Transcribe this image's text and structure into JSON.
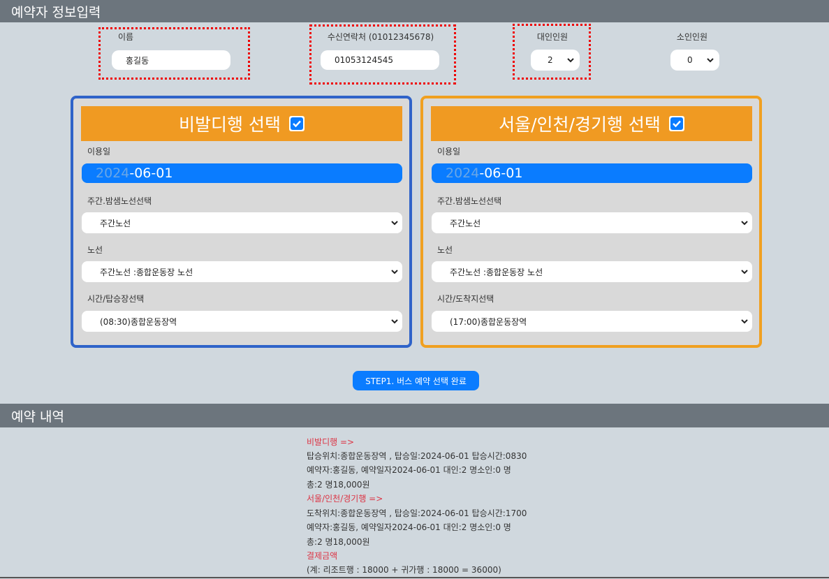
{
  "header": {
    "title": "예약자 정보입력"
  },
  "form": {
    "name_label": "이름",
    "name_value": "홍길동",
    "phone_label": "수신연락처 (01012345678)",
    "phone_value": "01053124545",
    "adult_label": "대인인원",
    "adult_value": "2",
    "child_label": "소인인원",
    "child_value": "0"
  },
  "left_panel": {
    "title": "비발디행 선택",
    "checked": true,
    "date_label": "이용일",
    "date_year": "2024",
    "date_rest": "-06-01",
    "shift_label": "주간.밤샘노선선택",
    "shift_value": "주간노선",
    "route_label": "노선",
    "route_value": "주간노선 :종합운동장 노선",
    "time_label": "시간/탑승장선택",
    "time_value": "(08:30)종합운동장역"
  },
  "right_panel": {
    "title": "서울/인천/경기행 선택",
    "checked": true,
    "date_label": "이용일",
    "date_year": "2024",
    "date_rest": "-06-01",
    "shift_label": "주간.밤샘노선선택",
    "shift_value": "주간노선",
    "route_label": "노선",
    "route_value": "주간노선 :종합운동장 노선",
    "time_label": "시간/도착지선택",
    "time_value": "(17:00)종합운동장역"
  },
  "step_button": {
    "label": "STEP1. 버스 예약 선택 완료"
  },
  "reservation": {
    "title": "예약 내역",
    "lines": [
      "비발디행 =>",
      "탑승위치:종합운동장역 , 탑승일:2024-06-01 탑승시간:0830",
      "예약자:홍길동, 예약일자2024-06-01 대인:2 명소인:0 명",
      "총:2 명18,000원",
      "서울/인천/경기행 =>",
      "도착위치:종합운동장역 , 탑승일:2024-06-01 탑승시간:1700",
      "예약자:홍길동, 예약일자2024-06-01 대인:2 명소인:0 명",
      "총:2 명18,000원",
      "결제금액",
      "(계: 리조트행 : 18000 + 귀가행 : 18000 = 36000)"
    ]
  },
  "colors": {
    "header_bg": "#6c757d",
    "page_bg": "#d0d8de",
    "primary_blue": "#0a7cff",
    "orange": "#f09a22",
    "left_border": "#2f63c9",
    "right_border": "#f0a020",
    "highlight_red": "#dc3545"
  }
}
